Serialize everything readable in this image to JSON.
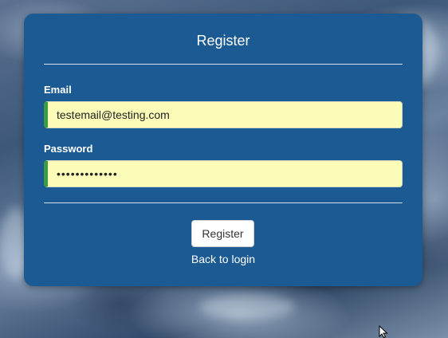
{
  "form": {
    "title": "Register",
    "email_label": "Email",
    "email_value": "testemail@testing.com",
    "password_label": "Password",
    "password_value": "testpassword1",
    "submit_label": "Register",
    "back_link": "Back to login"
  },
  "colors": {
    "panel": "#1b5a92",
    "input_background": "#fafcb8",
    "input_accent": "#3c9a45",
    "text": "#ffffff"
  },
  "icons": {
    "cursor": "mouse-pointer-icon"
  }
}
